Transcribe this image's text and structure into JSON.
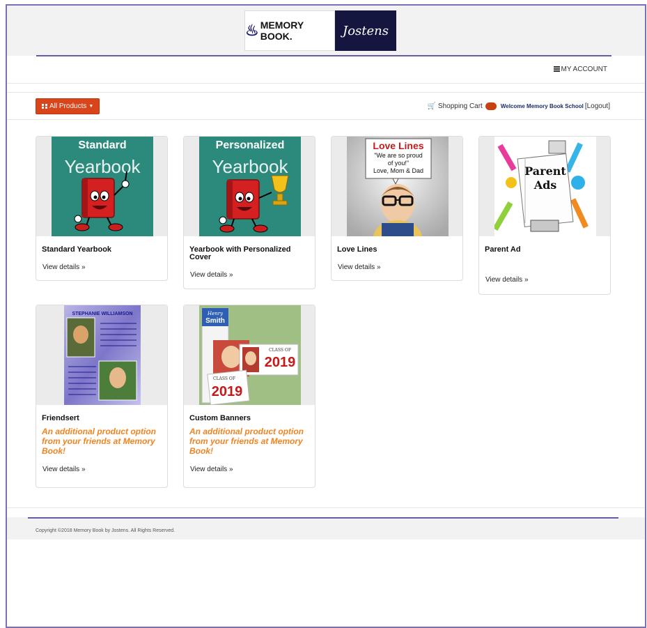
{
  "header": {
    "logo_left_text": "MEMORY BOOK.",
    "logo_right_text": "Jostens"
  },
  "account": {
    "my_account_label": "MY ACCOUNT"
  },
  "toolbar": {
    "all_products_label": "All Products",
    "shopping_cart_label": "Shopping Cart",
    "welcome_text": "Welcome Memory Book School",
    "logout_label": "[Logout]"
  },
  "products": [
    {
      "title": "Standard Yearbook",
      "image_heading": "Standard",
      "image_script": "Yearbook",
      "view": "View details »"
    },
    {
      "title": "Yearbook with Personalized Cover",
      "image_heading": "Personalized",
      "image_script": "Yearbook",
      "view": "View details »"
    },
    {
      "title": "Love Lines",
      "image_heading": "Love Lines",
      "image_quote1": "\"We are so proud",
      "image_quote2": "of you!\"",
      "image_quote3": "Love, Mom & Dad",
      "view": "View details »"
    },
    {
      "title": "Parent Ad",
      "image_heading1": "Parent",
      "image_heading2": "Ads",
      "view": "View details »"
    },
    {
      "title": "Friendsert",
      "image_heading": "STEPHANIE WILLIAMSON",
      "promo": "An additional product option from your friends at Memory Book!",
      "view": "View details »"
    },
    {
      "title": "Custom Banners",
      "image_name1": "Henry",
      "image_name2": "Smith",
      "image_class": "CLASS OF",
      "image_year": "2019",
      "promo": "An additional product option from your friends at Memory Book!",
      "view": "View details »"
    }
  ],
  "footer": {
    "copyright": "Copyright ©2018 Memory Book by Jostens. All Rights Reserved."
  },
  "colors": {
    "accent_purple": "#6a58a8",
    "button_orange": "#d9441a",
    "promo_orange": "#f2831f",
    "chalk_green": "#2c8a7d"
  }
}
